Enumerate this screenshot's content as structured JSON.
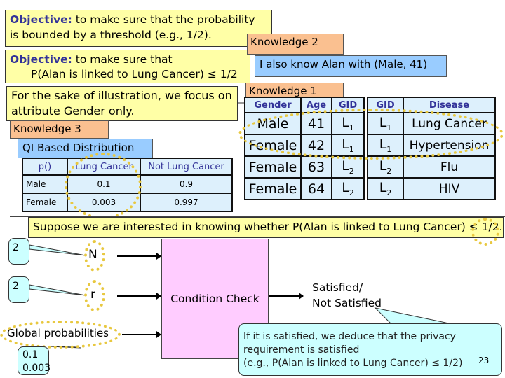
{
  "objective1": {
    "keyword": "Objective:",
    "line1": " to make sure that the probability",
    "line2": "is bounded by a threshold (e.g., 1/2)."
  },
  "objective2": {
    "keyword": "Objective:",
    "line1": " to make sure that",
    "line2": "P(Alan is linked to Lung Cancer) ≤ 1/2"
  },
  "knowledge2": {
    "label": "Knowledge 2",
    "text": "I also know Alan with (Male, 41)"
  },
  "illustration": {
    "text": "For the sake of illustration, we focus on attribute Gender only."
  },
  "knowledge1": {
    "label": "Knowledge 1"
  },
  "knowledge3": {
    "label": "Knowledge 3",
    "title": "QI Based Distribution"
  },
  "qi_table": {
    "headers": [
      "p()",
      "Lung Cancer",
      "Not Lung Cancer"
    ],
    "rows": [
      [
        "Male",
        "0.1",
        "0.9"
      ],
      [
        "Female",
        "0.003",
        "0.997"
      ]
    ]
  },
  "qi_groups": {
    "headers": [
      "Gender",
      "Age",
      "GID"
    ],
    "rows": [
      [
        "Male",
        "41",
        "L",
        "1"
      ],
      [
        "Female",
        "42",
        "L",
        "1"
      ],
      [
        "Female",
        "63",
        "L",
        "2"
      ],
      [
        "Female",
        "64",
        "L",
        "2"
      ]
    ]
  },
  "sensitive": {
    "headers": [
      "GID",
      "Disease"
    ],
    "rows": [
      [
        "L",
        "1",
        "Lung Cancer"
      ],
      [
        "L",
        "1",
        "Hypertension"
      ],
      [
        "L",
        "2",
        "Flu"
      ],
      [
        "L",
        "2",
        "HIV"
      ]
    ]
  },
  "question": "Suppose we are interested in knowing whether P(Alan is linked to Lung Cancer) ≤ 1/2.",
  "diagram": {
    "n_value": "2",
    "n_label": "N",
    "r_value": "2",
    "r_label": "r",
    "global_label": "Global probabilities",
    "global_values": [
      "0.1",
      "0.003"
    ],
    "box_label": "Condition Check",
    "output_line1": "Satisfied/",
    "output_line2": "Not Satisfied",
    "note_lines": [
      "If it is satisfied, we deduce that the privacy",
      "requirement is satisfied",
      "(e.g., P(Alan is linked to Lung Cancer) ≤ 1/2)"
    ]
  },
  "page_number": "23",
  "colors": {
    "yellow": "#ffffa6",
    "orange": "#fac090",
    "blue": "#99ccff",
    "pink": "#ffccff",
    "cyan": "#ccffff",
    "highlight": "#e8c840"
  }
}
